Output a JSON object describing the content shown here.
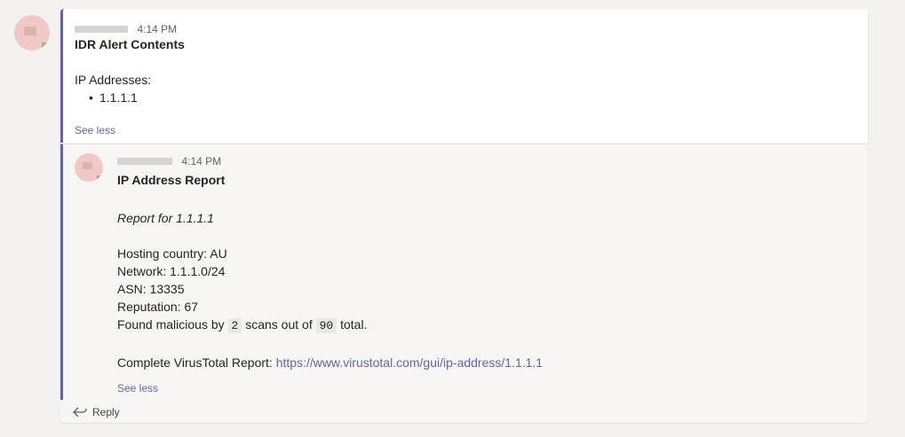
{
  "root": {
    "time": "4:14 PM",
    "title": "IDR Alert Contents",
    "section_label": "IP Addresses:",
    "ip_list": [
      "1.1.1.1"
    ],
    "see_less": "See less"
  },
  "reply": {
    "time": "4:14 PM",
    "title": "IP Address Report",
    "report_for": "Report for 1.1.1.1",
    "hosting_country": "Hosting country: AU",
    "network": "Network: 1.1.1.0/24",
    "asn": "ASN: 13335",
    "reputation": "Reputation: 67",
    "found_prefix": "Found malicious by",
    "malicious_count": "2",
    "found_middle": "scans out of",
    "total_count": "90",
    "found_suffix": "total.",
    "vt_label": "Complete VirusTotal Report:",
    "vt_url": "https://www.virustotal.com/gui/ip-address/1.1.1.1",
    "see_less": "See less"
  },
  "reply_button": {
    "label": "Reply",
    "icon": "reply-arrow-icon"
  },
  "colors": {
    "accent": "#6264a7",
    "presence": "#92c353"
  }
}
